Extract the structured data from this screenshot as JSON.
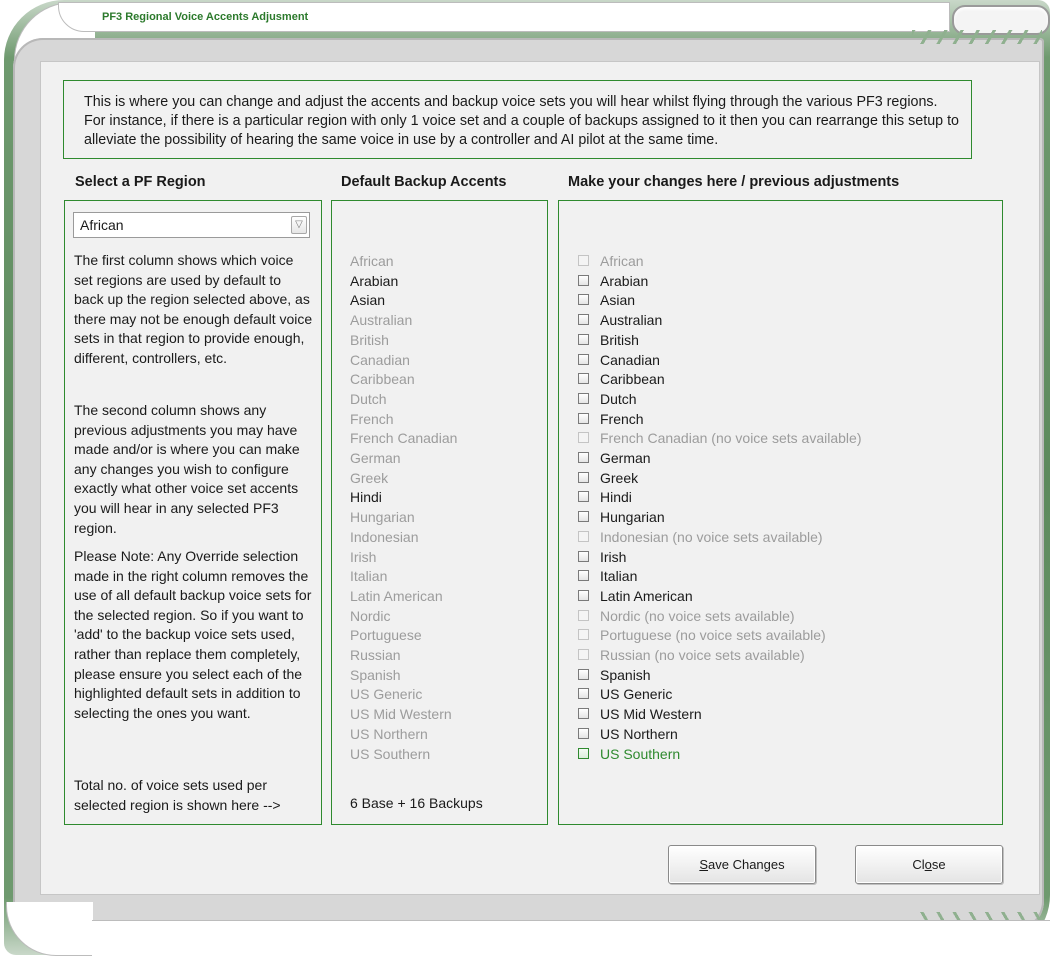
{
  "window": {
    "title": "PF3 Regional Voice Accents Adjusment"
  },
  "intro": {
    "text": "This is where you can change and adjust the accents and backup voice sets you will hear whilst flying through the various PF3 regions. For instance, if there is a particular region with only 1 voice set and a couple of backups assigned to it then you can rearrange this setup to alleviate the possibility of hearing the same voice in use by a controller and AI pilot at the same time."
  },
  "columns": {
    "region_heading": "Select a PF Region",
    "backup_heading": "Default Backup Accents",
    "changes_heading": "Make your changes here / previous adjustments"
  },
  "region_select": {
    "value": "African"
  },
  "description": [
    "The first column shows which voice set regions are used by default to back up the region selected above, as there may not be enough default voice sets in that region to provide enough, different, controllers, etc.",
    "The second column shows any previous adjustments you may have made and/or is where you can make any changes you wish to configure exactly what other voice set accents you will hear in any selected PF3 region.",
    "Please Note: Any Override selection made in the right column removes the use of all default backup voice sets for the selected region. So if you want to 'add' to the backup voice sets used, rather than replace them completely, please ensure you select each of the highlighted default sets in addition to selecting the ones you want.",
    "Total no. of voice sets used per selected region is shown here -->"
  ],
  "default_backups": [
    {
      "label": "African",
      "state": "grey"
    },
    {
      "label": "Arabian",
      "state": "dark"
    },
    {
      "label": "Asian",
      "state": "dark"
    },
    {
      "label": "Australian",
      "state": "grey"
    },
    {
      "label": "British",
      "state": "grey"
    },
    {
      "label": "Canadian",
      "state": "grey"
    },
    {
      "label": "Caribbean",
      "state": "grey"
    },
    {
      "label": "Dutch",
      "state": "grey"
    },
    {
      "label": "French",
      "state": "grey"
    },
    {
      "label": "French Canadian",
      "state": "grey"
    },
    {
      "label": "German",
      "state": "grey"
    },
    {
      "label": "Greek",
      "state": "grey"
    },
    {
      "label": "Hindi",
      "state": "dark"
    },
    {
      "label": "Hungarian",
      "state": "grey"
    },
    {
      "label": "Indonesian",
      "state": "grey"
    },
    {
      "label": "Irish",
      "state": "grey"
    },
    {
      "label": "Italian",
      "state": "grey"
    },
    {
      "label": "Latin American",
      "state": "grey"
    },
    {
      "label": "Nordic",
      "state": "grey"
    },
    {
      "label": "Portuguese",
      "state": "grey"
    },
    {
      "label": "Russian",
      "state": "grey"
    },
    {
      "label": "Spanish",
      "state": "grey"
    },
    {
      "label": "US Generic",
      "state": "grey"
    },
    {
      "label": "US Mid Western",
      "state": "grey"
    },
    {
      "label": "US Northern",
      "state": "grey"
    },
    {
      "label": "US Southern",
      "state": "grey"
    }
  ],
  "totals": "6 Base + 16 Backups",
  "overrides": [
    {
      "label": "African",
      "state": "disabled"
    },
    {
      "label": "Arabian",
      "state": "enabled"
    },
    {
      "label": "Asian",
      "state": "enabled"
    },
    {
      "label": "Australian",
      "state": "enabled"
    },
    {
      "label": "British",
      "state": "enabled"
    },
    {
      "label": "Canadian",
      "state": "enabled"
    },
    {
      "label": "Caribbean",
      "state": "enabled"
    },
    {
      "label": "Dutch",
      "state": "enabled"
    },
    {
      "label": "French",
      "state": "enabled"
    },
    {
      "label": "French Canadian (no voice sets available)",
      "state": "disabled"
    },
    {
      "label": "German",
      "state": "enabled"
    },
    {
      "label": "Greek",
      "state": "enabled"
    },
    {
      "label": "Hindi",
      "state": "enabled"
    },
    {
      "label": "Hungarian",
      "state": "enabled"
    },
    {
      "label": "Indonesian (no voice sets available)",
      "state": "disabled"
    },
    {
      "label": "Irish",
      "state": "enabled"
    },
    {
      "label": "Italian",
      "state": "enabled"
    },
    {
      "label": "Latin American",
      "state": "enabled"
    },
    {
      "label": "Nordic (no voice sets available)",
      "state": "disabled"
    },
    {
      "label": "Portuguese (no voice sets available)",
      "state": "disabled"
    },
    {
      "label": "Russian (no voice sets available)",
      "state": "disabled"
    },
    {
      "label": "Spanish",
      "state": "enabled"
    },
    {
      "label": "US Generic",
      "state": "enabled"
    },
    {
      "label": "US Mid Western",
      "state": "enabled"
    },
    {
      "label": "US Northern",
      "state": "enabled"
    },
    {
      "label": "US Southern",
      "state": "highlighted"
    }
  ],
  "buttons": {
    "save_access_key": "S",
    "save_rest": "ave Changes",
    "close_pre": "Cl",
    "close_access_key": "o",
    "close_post": "se"
  },
  "colors": {
    "accent": "#2f8a2f",
    "frame": "#5d8a5d",
    "panel_bg": "#f1f1f1",
    "muted_text": "#9c9c9c"
  }
}
